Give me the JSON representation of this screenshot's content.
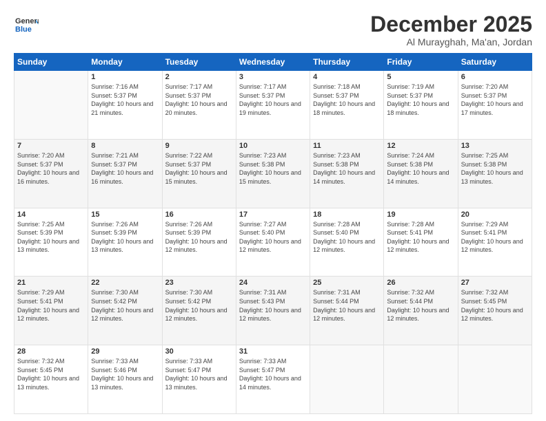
{
  "logo": {
    "general": "General",
    "blue": "Blue"
  },
  "title": "December 2025",
  "location": "Al Murayghah, Ma'an, Jordan",
  "days_header": [
    "Sunday",
    "Monday",
    "Tuesday",
    "Wednesday",
    "Thursday",
    "Friday",
    "Saturday"
  ],
  "weeks": [
    [
      {
        "num": "",
        "sunrise": "",
        "sunset": "",
        "daylight": "",
        "empty": true
      },
      {
        "num": "1",
        "sunrise": "Sunrise: 7:16 AM",
        "sunset": "Sunset: 5:37 PM",
        "daylight": "Daylight: 10 hours and 21 minutes."
      },
      {
        "num": "2",
        "sunrise": "Sunrise: 7:17 AM",
        "sunset": "Sunset: 5:37 PM",
        "daylight": "Daylight: 10 hours and 20 minutes."
      },
      {
        "num": "3",
        "sunrise": "Sunrise: 7:17 AM",
        "sunset": "Sunset: 5:37 PM",
        "daylight": "Daylight: 10 hours and 19 minutes."
      },
      {
        "num": "4",
        "sunrise": "Sunrise: 7:18 AM",
        "sunset": "Sunset: 5:37 PM",
        "daylight": "Daylight: 10 hours and 18 minutes."
      },
      {
        "num": "5",
        "sunrise": "Sunrise: 7:19 AM",
        "sunset": "Sunset: 5:37 PM",
        "daylight": "Daylight: 10 hours and 18 minutes."
      },
      {
        "num": "6",
        "sunrise": "Sunrise: 7:20 AM",
        "sunset": "Sunset: 5:37 PM",
        "daylight": "Daylight: 10 hours and 17 minutes."
      }
    ],
    [
      {
        "num": "7",
        "sunrise": "Sunrise: 7:20 AM",
        "sunset": "Sunset: 5:37 PM",
        "daylight": "Daylight: 10 hours and 16 minutes."
      },
      {
        "num": "8",
        "sunrise": "Sunrise: 7:21 AM",
        "sunset": "Sunset: 5:37 PM",
        "daylight": "Daylight: 10 hours and 16 minutes."
      },
      {
        "num": "9",
        "sunrise": "Sunrise: 7:22 AM",
        "sunset": "Sunset: 5:37 PM",
        "daylight": "Daylight: 10 hours and 15 minutes."
      },
      {
        "num": "10",
        "sunrise": "Sunrise: 7:23 AM",
        "sunset": "Sunset: 5:38 PM",
        "daylight": "Daylight: 10 hours and 15 minutes."
      },
      {
        "num": "11",
        "sunrise": "Sunrise: 7:23 AM",
        "sunset": "Sunset: 5:38 PM",
        "daylight": "Daylight: 10 hours and 14 minutes."
      },
      {
        "num": "12",
        "sunrise": "Sunrise: 7:24 AM",
        "sunset": "Sunset: 5:38 PM",
        "daylight": "Daylight: 10 hours and 14 minutes."
      },
      {
        "num": "13",
        "sunrise": "Sunrise: 7:25 AM",
        "sunset": "Sunset: 5:38 PM",
        "daylight": "Daylight: 10 hours and 13 minutes."
      }
    ],
    [
      {
        "num": "14",
        "sunrise": "Sunrise: 7:25 AM",
        "sunset": "Sunset: 5:39 PM",
        "daylight": "Daylight: 10 hours and 13 minutes."
      },
      {
        "num": "15",
        "sunrise": "Sunrise: 7:26 AM",
        "sunset": "Sunset: 5:39 PM",
        "daylight": "Daylight: 10 hours and 13 minutes."
      },
      {
        "num": "16",
        "sunrise": "Sunrise: 7:26 AM",
        "sunset": "Sunset: 5:39 PM",
        "daylight": "Daylight: 10 hours and 12 minutes."
      },
      {
        "num": "17",
        "sunrise": "Sunrise: 7:27 AM",
        "sunset": "Sunset: 5:40 PM",
        "daylight": "Daylight: 10 hours and 12 minutes."
      },
      {
        "num": "18",
        "sunrise": "Sunrise: 7:28 AM",
        "sunset": "Sunset: 5:40 PM",
        "daylight": "Daylight: 10 hours and 12 minutes."
      },
      {
        "num": "19",
        "sunrise": "Sunrise: 7:28 AM",
        "sunset": "Sunset: 5:41 PM",
        "daylight": "Daylight: 10 hours and 12 minutes."
      },
      {
        "num": "20",
        "sunrise": "Sunrise: 7:29 AM",
        "sunset": "Sunset: 5:41 PM",
        "daylight": "Daylight: 10 hours and 12 minutes."
      }
    ],
    [
      {
        "num": "21",
        "sunrise": "Sunrise: 7:29 AM",
        "sunset": "Sunset: 5:41 PM",
        "daylight": "Daylight: 10 hours and 12 minutes."
      },
      {
        "num": "22",
        "sunrise": "Sunrise: 7:30 AM",
        "sunset": "Sunset: 5:42 PM",
        "daylight": "Daylight: 10 hours and 12 minutes."
      },
      {
        "num": "23",
        "sunrise": "Sunrise: 7:30 AM",
        "sunset": "Sunset: 5:42 PM",
        "daylight": "Daylight: 10 hours and 12 minutes."
      },
      {
        "num": "24",
        "sunrise": "Sunrise: 7:31 AM",
        "sunset": "Sunset: 5:43 PM",
        "daylight": "Daylight: 10 hours and 12 minutes."
      },
      {
        "num": "25",
        "sunrise": "Sunrise: 7:31 AM",
        "sunset": "Sunset: 5:44 PM",
        "daylight": "Daylight: 10 hours and 12 minutes."
      },
      {
        "num": "26",
        "sunrise": "Sunrise: 7:32 AM",
        "sunset": "Sunset: 5:44 PM",
        "daylight": "Daylight: 10 hours and 12 minutes."
      },
      {
        "num": "27",
        "sunrise": "Sunrise: 7:32 AM",
        "sunset": "Sunset: 5:45 PM",
        "daylight": "Daylight: 10 hours and 12 minutes."
      }
    ],
    [
      {
        "num": "28",
        "sunrise": "Sunrise: 7:32 AM",
        "sunset": "Sunset: 5:45 PM",
        "daylight": "Daylight: 10 hours and 13 minutes."
      },
      {
        "num": "29",
        "sunrise": "Sunrise: 7:33 AM",
        "sunset": "Sunset: 5:46 PM",
        "daylight": "Daylight: 10 hours and 13 minutes."
      },
      {
        "num": "30",
        "sunrise": "Sunrise: 7:33 AM",
        "sunset": "Sunset: 5:47 PM",
        "daylight": "Daylight: 10 hours and 13 minutes."
      },
      {
        "num": "31",
        "sunrise": "Sunrise: 7:33 AM",
        "sunset": "Sunset: 5:47 PM",
        "daylight": "Daylight: 10 hours and 14 minutes."
      },
      {
        "num": "",
        "sunrise": "",
        "sunset": "",
        "daylight": "",
        "empty": true
      },
      {
        "num": "",
        "sunrise": "",
        "sunset": "",
        "daylight": "",
        "empty": true
      },
      {
        "num": "",
        "sunrise": "",
        "sunset": "",
        "daylight": "",
        "empty": true
      }
    ]
  ]
}
